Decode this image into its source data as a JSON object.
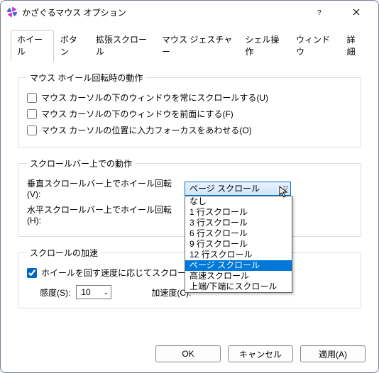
{
  "title": "かざぐるマウス オプション",
  "tabs": [
    "ホイール",
    "ボタン",
    "拡張スクロール",
    "マウス ジェスチャー",
    "シェル操作",
    "ウィンドウ",
    "詳細"
  ],
  "active_tab_index": 0,
  "group1": {
    "legend": "マウス ホイール回転時の動作",
    "chk1": {
      "label": "マウス カーソルの下のウィンドウを常にスクロールする(U)",
      "checked": false
    },
    "chk2": {
      "label": "マウス カーソルの下のウィンドウを前面にする(F)",
      "checked": false
    },
    "chk3": {
      "label": "マウス カーソルの位置に入力フォーカスをあわせる(O)",
      "checked": false
    }
  },
  "group2": {
    "legend": "スクロールバー上での動作",
    "row1": {
      "label": "垂直スクロールバー上でホイール回転(V):",
      "value": "ページ スクロール"
    },
    "row2": {
      "label": "水平スクロールバー上でホイール回転(H):"
    },
    "dropdown_options": [
      "なし",
      "1 行スクロール",
      "3 行スクロール",
      "6 行スクロール",
      "9 行スクロール",
      "12 行スクロール",
      "ページ スクロール",
      "高速スクロール",
      "上端/下端にスクロール"
    ],
    "dropdown_selected_index": 6
  },
  "group3": {
    "legend": "スクロールの加速",
    "chk": {
      "label": "ホイールを回す速度に応じてスクロールを加",
      "checked": true
    },
    "sens_label": "感度(S):",
    "sens_value": "10",
    "accel_label": "加速度(C):"
  },
  "buttons": {
    "ok": "OK",
    "cancel": "キャンセル",
    "apply": "適用(A)"
  }
}
